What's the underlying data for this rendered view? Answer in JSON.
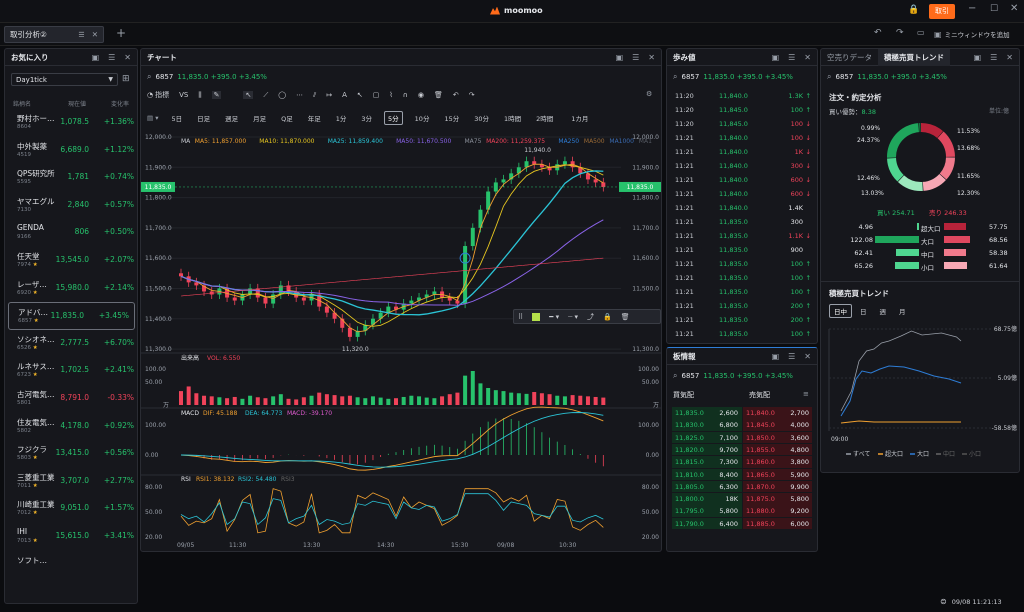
{
  "app": {
    "brand": "moomoo",
    "trade_button": "取引",
    "mini_window": "ミニウィンドウを追加",
    "datetime": "09/08 11:21:13"
  },
  "tabs": [
    {
      "label": "取引分析②"
    }
  ],
  "watchlist": {
    "title": "お気に入り",
    "group": "Day1tick",
    "headers": {
      "name": "銘柄名",
      "price": "現在値",
      "change": "変化率"
    },
    "items": [
      {
        "name": "野村ホー…",
        "code": "8604",
        "price": "1,078.5",
        "change": "+1.36%",
        "dir": "up"
      },
      {
        "name": "中外製薬",
        "code": "4519",
        "price": "6,689.0",
        "change": "+1.12%",
        "dir": "up"
      },
      {
        "name": "QPS研究所",
        "code": "5595",
        "price": "1,781",
        "change": "+0.74%",
        "dir": "up"
      },
      {
        "name": "ヤマエグル…",
        "code": "7130",
        "price": "2,840",
        "change": "+0.57%",
        "dir": "up"
      },
      {
        "name": "GENDA",
        "code": "9166",
        "price": "806",
        "change": "+0.50%",
        "dir": "up"
      },
      {
        "name": "任天堂",
        "code": "7974",
        "price": "13,545.0",
        "change": "+2.07%",
        "dir": "up",
        "star": true
      },
      {
        "name": "レーザ…",
        "code": "6920",
        "price": "15,980.0",
        "change": "+2.14%",
        "dir": "up",
        "star": true
      },
      {
        "name": "アドバ…",
        "code": "6857",
        "price": "11,835.0",
        "change": "+3.45%",
        "dir": "up",
        "star": true,
        "selected": true
      },
      {
        "name": "ソシオネ…",
        "code": "6526",
        "price": "2,777.5",
        "change": "+6.70%",
        "dir": "up",
        "star": true
      },
      {
        "name": "ルネサス…",
        "code": "6723",
        "price": "1,702.5",
        "change": "+2.41%",
        "dir": "up",
        "star": true
      },
      {
        "name": "古河電気…",
        "code": "5801",
        "price": "8,791.0",
        "change": "-0.33%",
        "dir": "down"
      },
      {
        "name": "住友電気…",
        "code": "5802",
        "price": "4,178.0",
        "change": "+0.92%",
        "dir": "up"
      },
      {
        "name": "フジクラ",
        "code": "5803",
        "price": "13,415.0",
        "change": "+0.56%",
        "dir": "up",
        "star": true
      },
      {
        "name": "三菱重工業",
        "code": "7011",
        "price": "3,707.0",
        "change": "+2.77%",
        "dir": "up",
        "star": true
      },
      {
        "name": "川崎重工業",
        "code": "7012",
        "price": "9,051.0",
        "change": "+1.57%",
        "dir": "up",
        "star": true
      },
      {
        "name": "IHI",
        "code": "7013",
        "price": "15,615.0",
        "change": "+3.41%",
        "dir": "up",
        "star": true
      },
      {
        "name": "ソフト…",
        "code": "",
        "price": "",
        "change": "",
        "dir": "up"
      }
    ]
  },
  "chart": {
    "title": "チャート",
    "symbol": "6857",
    "quote": "11,835.0 +395.0 +3.45%",
    "toolbar": {
      "indicator": "指標",
      "vs": "VS"
    },
    "periods": [
      "5日",
      "日足",
      "週足",
      "月足",
      "Q足",
      "年足",
      "1分",
      "3分",
      "5分",
      "10分",
      "15分",
      "30分",
      "1時間",
      "2時間",
      "1カ月"
    ],
    "active_period": "5分",
    "ma_legend": [
      {
        "label": "MA",
        "color": "#c9ccd2"
      },
      {
        "label": "MA5: 11,857.000",
        "color": "#f0a030"
      },
      {
        "label": "MA10: 11,870.000",
        "color": "#e6c620"
      },
      {
        "label": "MA25: 11,859.400",
        "color": "#2bc4d6"
      },
      {
        "label": "MA50: 11,670.500",
        "color": "#8a63e8"
      },
      {
        "label": "MA75",
        "color": "#8a8f99"
      },
      {
        "label": "MA200: 11,259.375",
        "color": "#f0435a"
      },
      {
        "label": "MA250",
        "color": "#2e7dd6"
      },
      {
        "label": "MA500",
        "color": "#9b6b36"
      },
      {
        "label": "MA1000",
        "color": "#3a6ab0"
      },
      {
        "label": "MA1",
        "color": "#555a63"
      }
    ],
    "current_price_tag": "11,835.0",
    "high_label": "11,940.0",
    "low_label": "11,320.0",
    "volume_legend": {
      "name": "出来高",
      "value": "VOL: 6.550"
    },
    "volume_axis_unit": "万",
    "macd_legend": {
      "name": "MACD",
      "dif": "DIF: 45.188",
      "dea": "DEA: 64.773",
      "macd": "MACD: -39.170"
    },
    "rsi_legend": {
      "name": "RSI",
      "rsi1": "RSI1: 38.132",
      "rsi2": "RSI2: 54.480",
      "rsi3": "RSI3"
    },
    "time_labels": [
      "09/05",
      "11:30",
      "13:30",
      "14:30",
      "15:30",
      "09/08",
      "10:30"
    ]
  },
  "chart_data": {
    "type": "candlestick",
    "yaxis_ticks": [
      "12,000.0",
      "11,900.0",
      "11,800.0",
      "11,700.0",
      "11,600.0",
      "11,500.0",
      "11,400.0",
      "11,300.0"
    ],
    "ylim": [
      11300,
      12000
    ],
    "volume_ticks": [
      "100.00",
      "50.00"
    ],
    "macd_ticks": [
      "100.00",
      "0.00"
    ],
    "rsi_ticks": [
      "80.00",
      "50.00",
      "20.00"
    ],
    "close": [
      11540,
      11520,
      11510,
      11490,
      11480,
      11500,
      11470,
      11460,
      11480,
      11500,
      11470,
      11450,
      11480,
      11510,
      11490,
      11470,
      11460,
      11480,
      11440,
      11420,
      11400,
      11370,
      11340,
      11360,
      11380,
      11400,
      11420,
      11440,
      11430,
      11450,
      11460,
      11470,
      11480,
      11490,
      11470,
      11460,
      11450,
      11640,
      11700,
      11760,
      11820,
      11850,
      11860,
      11880,
      11900,
      11920,
      11910,
      11900,
      11890,
      11910,
      11920,
      11900,
      11880,
      11860,
      11850,
      11835
    ],
    "volume": [
      45,
      60,
      38,
      30,
      28,
      25,
      22,
      26,
      20,
      30,
      25,
      22,
      28,
      35,
      20,
      18,
      25,
      30,
      40,
      35,
      32,
      28,
      30,
      25,
      22,
      28,
      24,
      20,
      22,
      26,
      30,
      28,
      24,
      22,
      28,
      35,
      40,
      95,
      110,
      70,
      55,
      48,
      45,
      40,
      38,
      36,
      42,
      38,
      35,
      30,
      28,
      32,
      30,
      28,
      26,
      24
    ]
  },
  "trades": {
    "title": "歩み値",
    "symbol": "6857",
    "quote": "11,835.0 +395.0 +3.45%",
    "rows": [
      {
        "time": "11:20",
        "price": "11,840.0",
        "vol": "1.3K",
        "dir": "up"
      },
      {
        "time": "11:20",
        "price": "11,845.0",
        "vol": "100",
        "dir": "up"
      },
      {
        "time": "11:20",
        "price": "11,845.0",
        "vol": "100",
        "dir": "down"
      },
      {
        "time": "11:21",
        "price": "11,840.0",
        "vol": "100",
        "dir": "down"
      },
      {
        "time": "11:21",
        "price": "11,840.0",
        "vol": "1K",
        "dir": "down"
      },
      {
        "time": "11:21",
        "price": "11,840.0",
        "vol": "300",
        "dir": "down"
      },
      {
        "time": "11:21",
        "price": "11,840.0",
        "vol": "600",
        "dir": "down"
      },
      {
        "time": "11:21",
        "price": "11,840.0",
        "vol": "600",
        "dir": "down"
      },
      {
        "time": "11:21",
        "price": "11,840.0",
        "vol": "1.4K",
        "dir": "none"
      },
      {
        "time": "11:21",
        "price": "11,835.0",
        "vol": "300",
        "dir": "none"
      },
      {
        "time": "11:21",
        "price": "11,835.0",
        "vol": "1.1K",
        "dir": "down"
      },
      {
        "time": "11:21",
        "price": "11,835.0",
        "vol": "900",
        "dir": "none"
      },
      {
        "time": "11:21",
        "price": "11,835.0",
        "vol": "100",
        "dir": "up"
      },
      {
        "time": "11:21",
        "price": "11,835.0",
        "vol": "100",
        "dir": "up"
      },
      {
        "time": "11:21",
        "price": "11,835.0",
        "vol": "100",
        "dir": "up"
      },
      {
        "time": "11:21",
        "price": "11,835.0",
        "vol": "200",
        "dir": "up"
      },
      {
        "time": "11:21",
        "price": "11,835.0",
        "vol": "200",
        "dir": "up"
      },
      {
        "time": "11:21",
        "price": "11,835.0",
        "vol": "100",
        "dir": "up"
      }
    ]
  },
  "orderbook": {
    "title": "板情報",
    "symbol": "6857",
    "quote": "11,835.0 +395.0 +3.45%",
    "bid_header": "買気配",
    "ask_header": "売気配",
    "rows": [
      {
        "bid": "11,835.0",
        "bid_qty": "2,600",
        "ask": "11,840.0",
        "ask_qty": "2,700"
      },
      {
        "bid": "11,830.0",
        "bid_qty": "6,800",
        "ask": "11,845.0",
        "ask_qty": "4,000"
      },
      {
        "bid": "11,825.0",
        "bid_qty": "7,100",
        "ask": "11,850.0",
        "ask_qty": "3,600"
      },
      {
        "bid": "11,820.0",
        "bid_qty": "9,700",
        "ask": "11,855.0",
        "ask_qty": "4,800"
      },
      {
        "bid": "11,815.0",
        "bid_qty": "7,300",
        "ask": "11,860.0",
        "ask_qty": "3,800"
      },
      {
        "bid": "11,810.0",
        "bid_qty": "8,400",
        "ask": "11,865.0",
        "ask_qty": "5,900"
      },
      {
        "bid": "11,805.0",
        "bid_qty": "6,300",
        "ask": "11,870.0",
        "ask_qty": "9,900"
      },
      {
        "bid": "11,800.0",
        "bid_qty": "18K",
        "ask": "11,875.0",
        "ask_qty": "5,800"
      },
      {
        "bid": "11,795.0",
        "bid_qty": "5,800",
        "ask": "11,880.0",
        "ask_qty": "9,200"
      },
      {
        "bid": "11,790.0",
        "bid_qty": "6,400",
        "ask": "11,885.0",
        "ask_qty": "6,000"
      }
    ]
  },
  "flow": {
    "tab_inactive": "空売りデータ",
    "tab_active": "積極売買トレンド",
    "symbol": "6857",
    "quote": "11,835.0 +395.0 +3.45%",
    "section_title": "注文・約定分析",
    "buy_strength_label": "買い優勢：",
    "buy_strength_value": "8.38",
    "unit": "単位:億",
    "donut_left": [
      "0.99%",
      "24.37%",
      "12.46%",
      "13.03%"
    ],
    "donut_right": [
      "11.53%",
      "13.68%",
      "11.65%",
      "12.30%"
    ],
    "donut_segments": [
      {
        "value": 11.53,
        "color": "#b8233a"
      },
      {
        "value": 13.68,
        "color": "#e0485f"
      },
      {
        "value": 11.65,
        "color": "#f07a8c"
      },
      {
        "value": 12.3,
        "color": "#f7a8b5"
      },
      {
        "value": 13.03,
        "color": "#9ce8bd"
      },
      {
        "value": 12.46,
        "color": "#4fd690"
      },
      {
        "value": 24.37,
        "color": "#1fa65c"
      },
      {
        "value": 0.99,
        "color": "#137a41"
      }
    ],
    "buy_total_label": "買い",
    "buy_total": "254.71",
    "sell_total_label": "売り",
    "sell_total": "246.33",
    "size_rows": [
      {
        "buy": "4.96",
        "label": "超大口",
        "sell": "57.75",
        "buy_frac": 0.05,
        "sell_frac": 0.55
      },
      {
        "buy": "122.08",
        "label": "大口",
        "sell": "68.56",
        "buy_frac": 1.0,
        "sell_frac": 0.65
      },
      {
        "buy": "62.41",
        "label": "中口",
        "sell": "58.38",
        "buy_frac": 0.52,
        "sell_frac": 0.55
      },
      {
        "buy": "65.26",
        "label": "小口",
        "sell": "61.64",
        "buy_frac": 0.54,
        "sell_frac": 0.58
      }
    ],
    "trend_title": "積極売買トレンド",
    "trend_tabs": [
      "日中",
      "日",
      "週",
      "月"
    ],
    "trend_axis": [
      "68.75億",
      "5.09億",
      "-58.58億"
    ],
    "trend_start": "09:00",
    "trend_legend": [
      {
        "label": "すべて",
        "color": "#9aa0aa"
      },
      {
        "label": "超大口",
        "color": "#f0a030"
      },
      {
        "label": "大口",
        "color": "#2e7dd6"
      },
      {
        "label": "中口",
        "color": "#666"
      },
      {
        "label": "小口",
        "color": "#555"
      }
    ]
  }
}
